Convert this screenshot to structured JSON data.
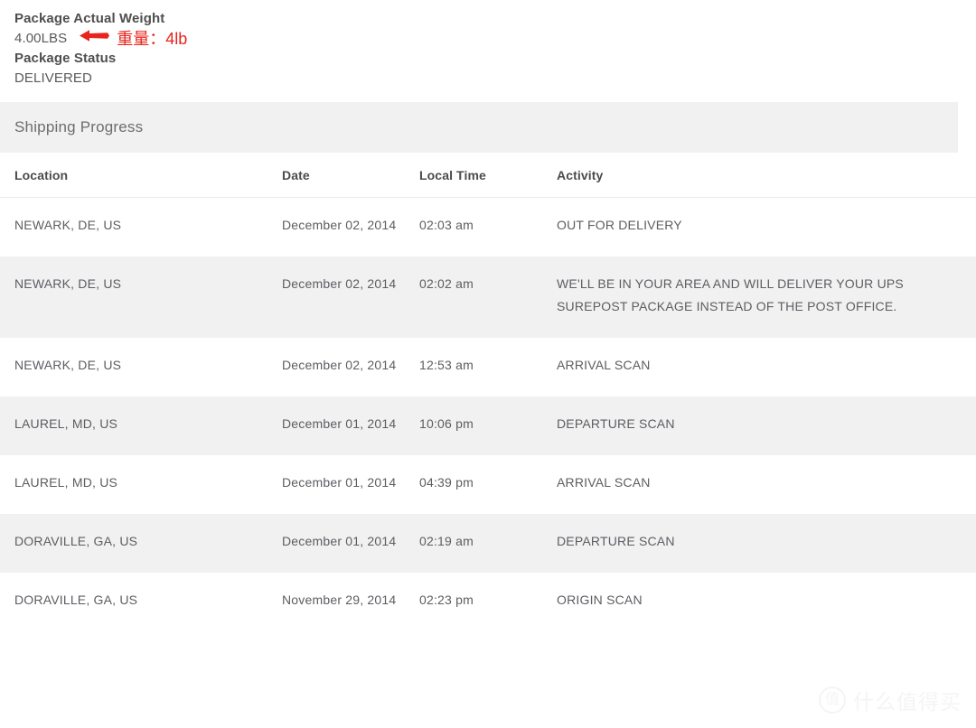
{
  "summary": {
    "weight_label": "Package Actual Weight",
    "weight_value": "4.00LBS",
    "status_label": "Package Status",
    "status_value": "DELIVERED",
    "annotation_text": "重量：4lb",
    "annotation_color": "#e8241c",
    "arrow_icon": "arrow-left-icon"
  },
  "progress": {
    "title": "Shipping Progress",
    "header_bg": "#f1f1f1"
  },
  "table": {
    "columns": [
      "Location",
      "Date",
      "Local Time",
      "Activity"
    ],
    "rows": [
      {
        "location": "NEWARK, DE, US",
        "date": "December 02, 2014",
        "time": "02:03 am",
        "activity": "OUT FOR DELIVERY"
      },
      {
        "location": "NEWARK, DE, US",
        "date": "December 02, 2014",
        "time": "02:02 am",
        "activity": "WE'LL BE IN YOUR AREA AND WILL DELIVER YOUR UPS SUREPOST PACKAGE INSTEAD OF THE POST OFFICE."
      },
      {
        "location": "NEWARK, DE, US",
        "date": "December 02, 2014",
        "time": "12:53 am",
        "activity": "ARRIVAL SCAN"
      },
      {
        "location": "LAUREL, MD, US",
        "date": "December 01, 2014",
        "time": "10:06 pm",
        "activity": "DEPARTURE SCAN"
      },
      {
        "location": "LAUREL, MD, US",
        "date": "December 01, 2014",
        "time": "04:39 pm",
        "activity": "ARRIVAL SCAN"
      },
      {
        "location": "DORAVILLE, GA, US",
        "date": "December 01, 2014",
        "time": "02:19 am",
        "activity": "DEPARTURE SCAN"
      },
      {
        "location": "DORAVILLE, GA, US",
        "date": "November 29, 2014",
        "time": "02:23 pm",
        "activity": "ORIGIN SCAN"
      }
    ]
  },
  "watermark": {
    "mark": "值",
    "text": "什么值得买"
  }
}
